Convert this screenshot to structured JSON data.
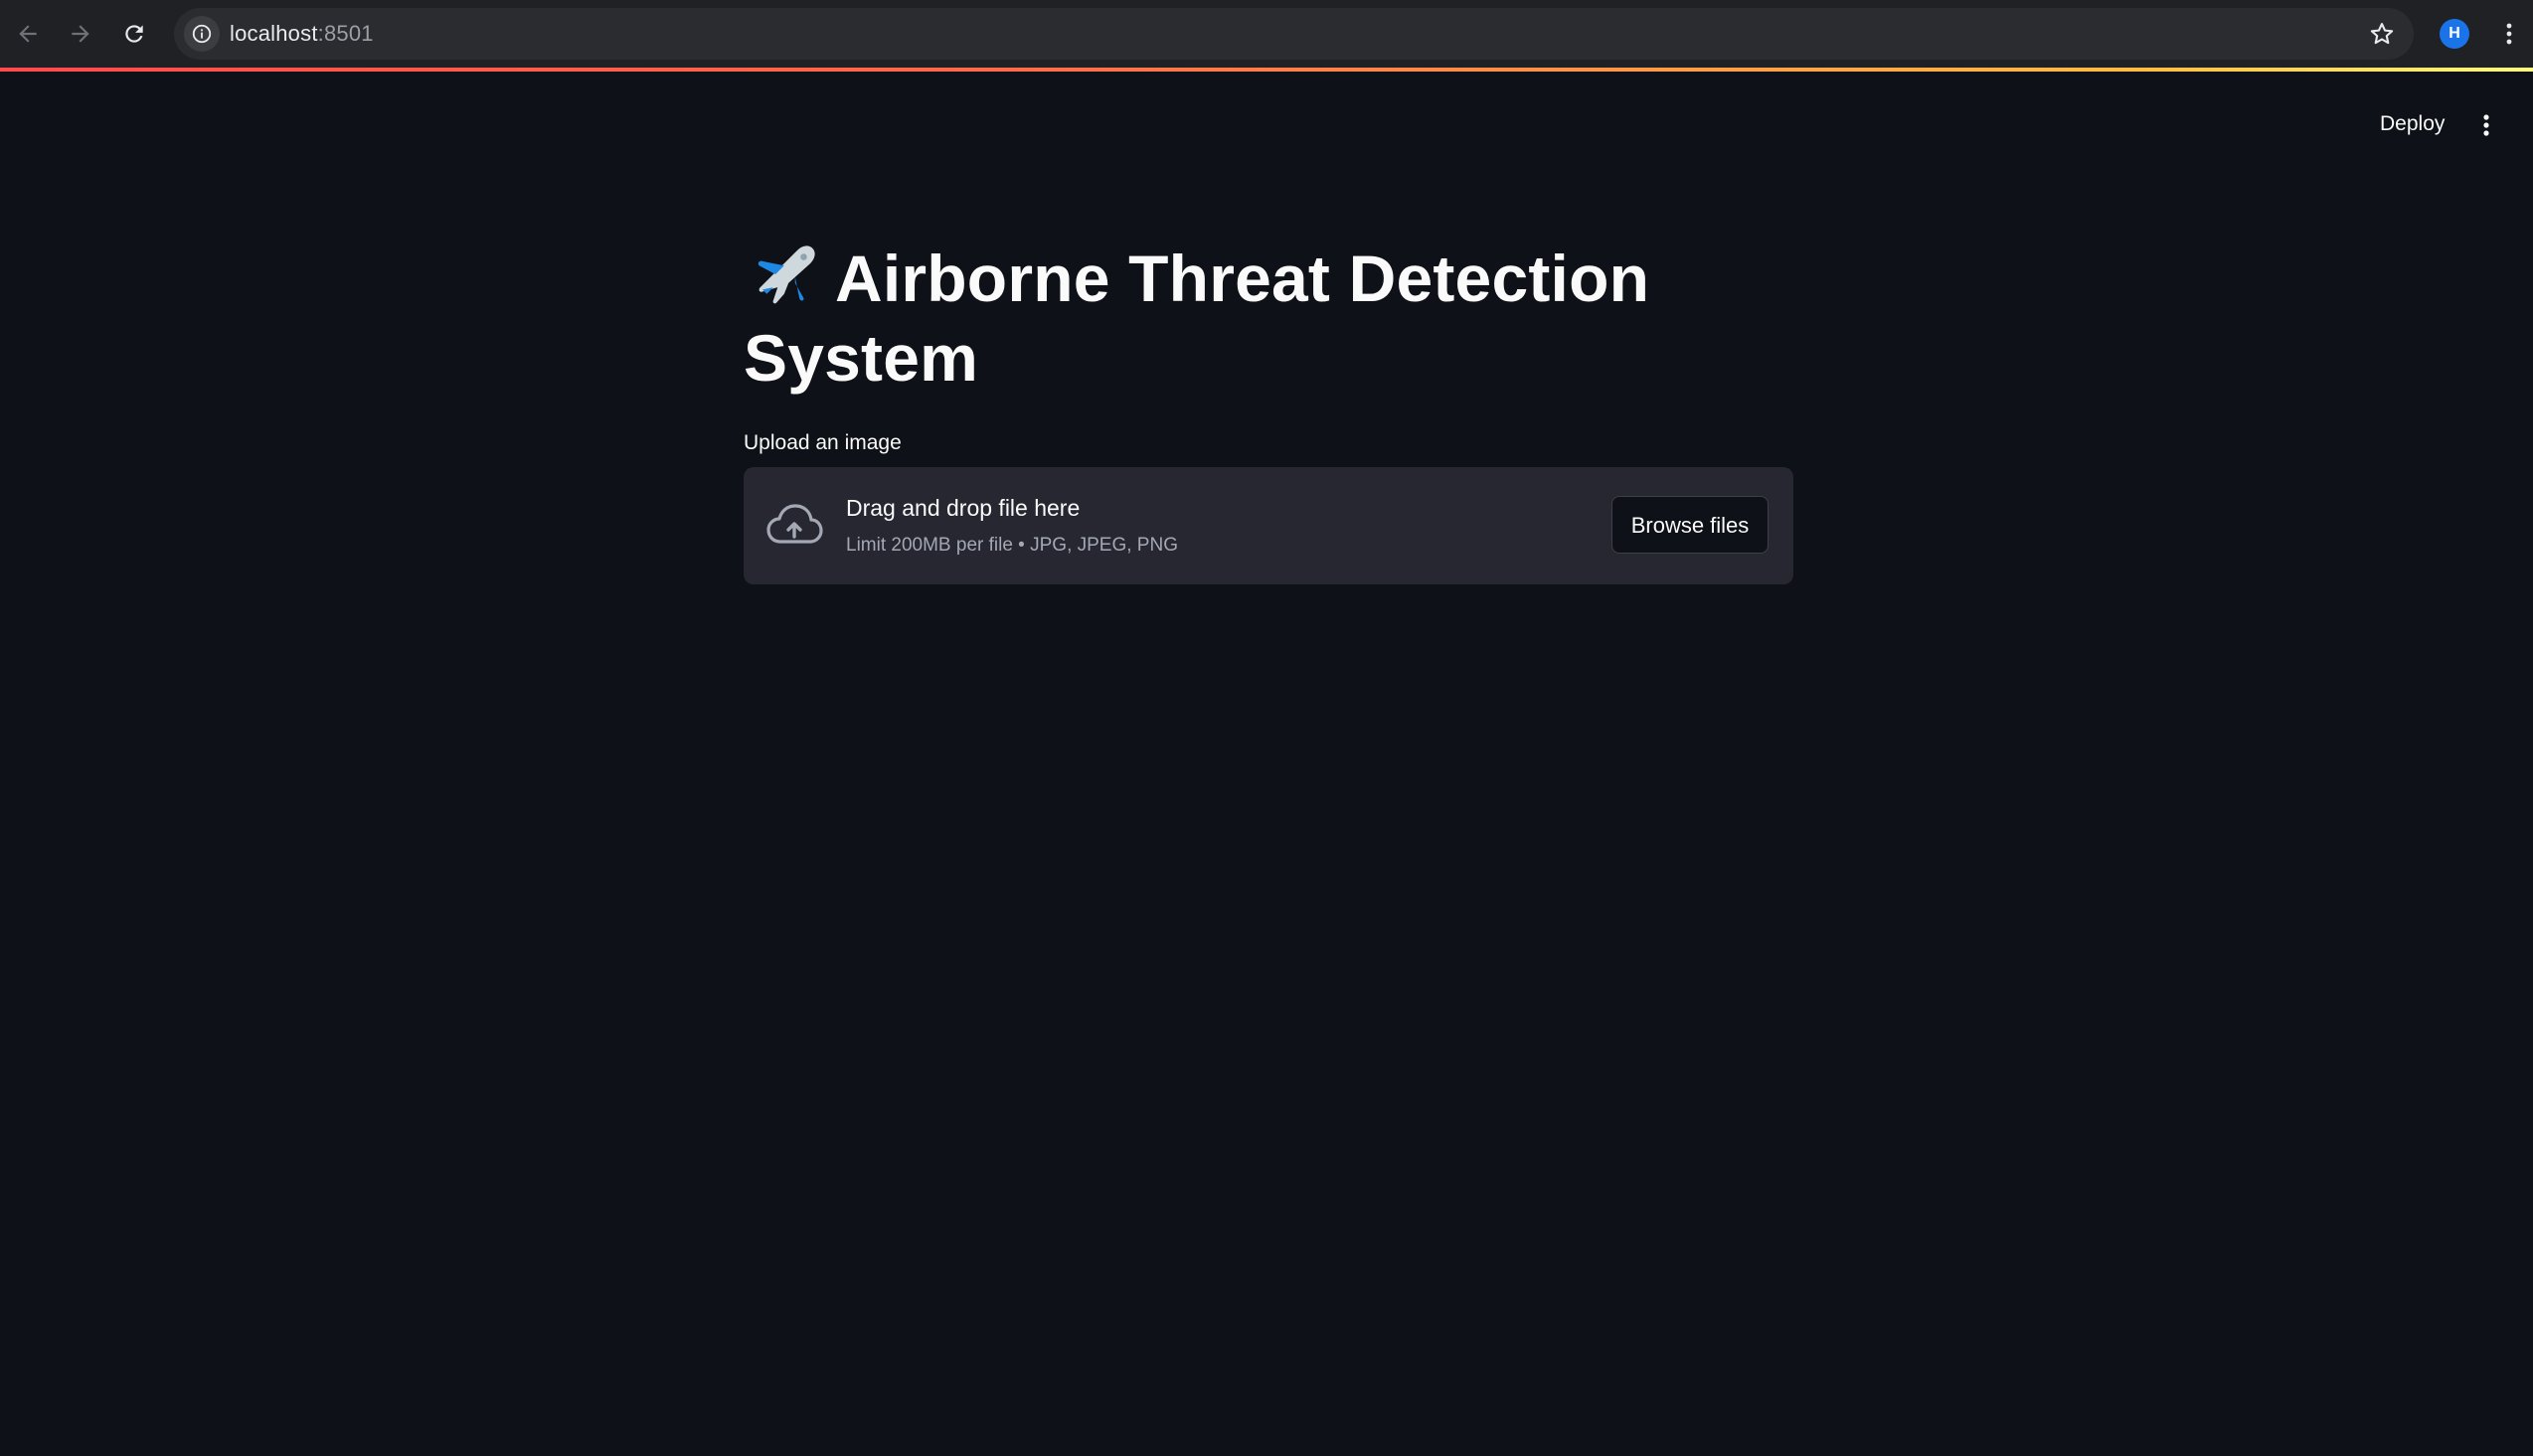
{
  "browser": {
    "url_host": "localhost",
    "url_port": ":8501",
    "profile_initial": "H",
    "icons": [
      "back-arrow-icon",
      "forward-arrow-icon",
      "reload-icon",
      "info-icon",
      "star-icon",
      "kebab-menu-icon"
    ]
  },
  "header": {
    "deploy_label": "Deploy",
    "menu_icon": "kebab-menu-icon"
  },
  "main": {
    "title_emoji": "airplane-icon",
    "title": "Airborne Threat Detection System",
    "uploader": {
      "label": "Upload an image",
      "drop_title": "Drag and drop file here",
      "limit_text": "Limit 200MB per file • JPG, JPEG, PNG",
      "browse_label": "Browse files",
      "icon": "cloud-upload-icon"
    }
  },
  "colors": {
    "background": "#0e1117",
    "dropzone": "#262730",
    "accent_stripe_start": "#ff4b4b",
    "accent_stripe_end": "#fffd80"
  }
}
